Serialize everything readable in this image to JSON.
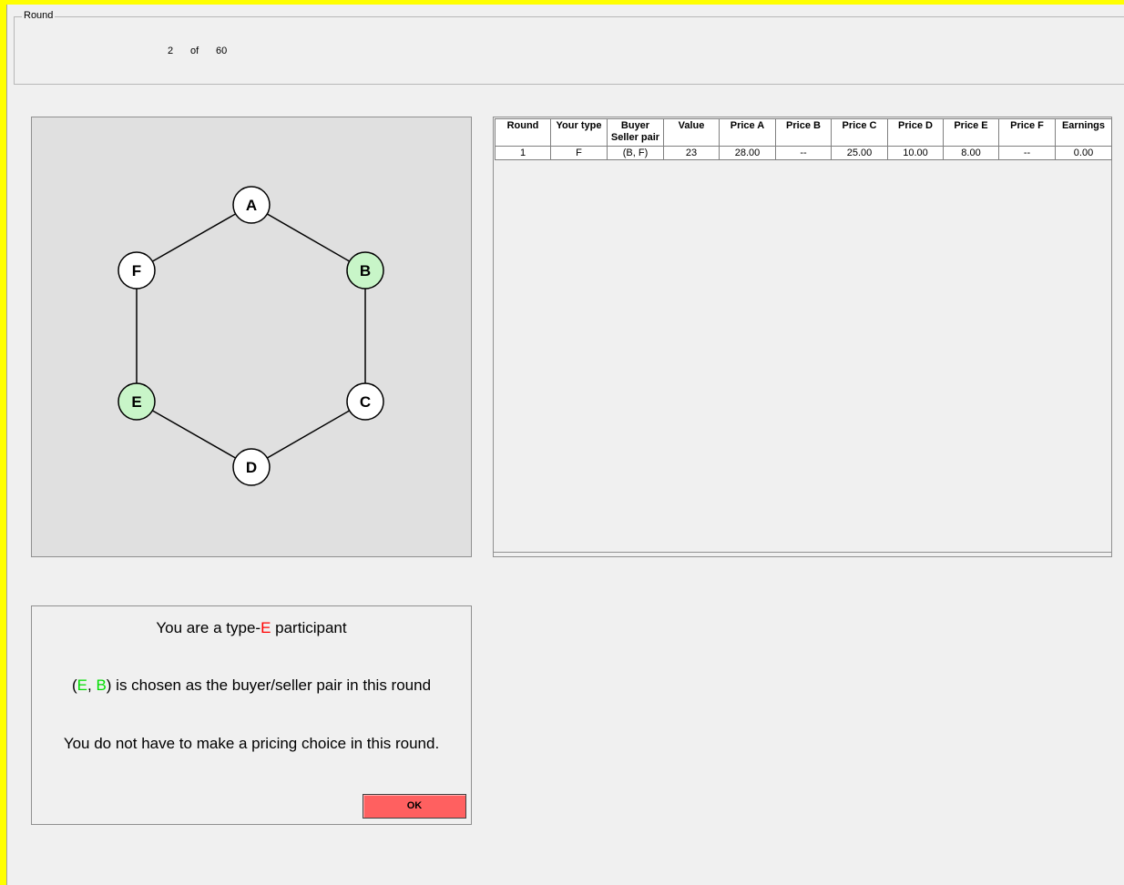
{
  "round": {
    "legend": "Round",
    "current": "2",
    "of_label": "of",
    "total": "60"
  },
  "graph": {
    "nodes": [
      {
        "id": "A",
        "label": "A",
        "fill": "#ffffff"
      },
      {
        "id": "B",
        "label": "B",
        "fill": "#c8f5c8"
      },
      {
        "id": "C",
        "label": "C",
        "fill": "#ffffff"
      },
      {
        "id": "D",
        "label": "D",
        "fill": "#ffffff"
      },
      {
        "id": "E",
        "label": "E",
        "fill": "#c8f5c8"
      },
      {
        "id": "F",
        "label": "F",
        "fill": "#ffffff"
      }
    ],
    "edges": [
      [
        "A",
        "B"
      ],
      [
        "B",
        "C"
      ],
      [
        "C",
        "D"
      ],
      [
        "D",
        "E"
      ],
      [
        "E",
        "F"
      ],
      [
        "F",
        "A"
      ]
    ]
  },
  "history_table": {
    "headers": {
      "round": "Round",
      "your_type": "Your type",
      "pair_line1": "Buyer",
      "pair_line2": "Seller pair",
      "value": "Value",
      "price_a": "Price A",
      "price_b": "Price B",
      "price_c": "Price C",
      "price_d": "Price D",
      "price_e": "Price E",
      "price_f": "Price F",
      "earnings": "Earnings"
    },
    "rows": [
      {
        "round": "1",
        "your_type": "F",
        "pair": "(B, F)",
        "value": "23",
        "price_a": "28.00",
        "price_b": "--",
        "price_c": "25.00",
        "price_d": "10.00",
        "price_e": "8.00",
        "price_f": "--",
        "earnings": "0.00"
      }
    ]
  },
  "message": {
    "line1_prefix": "You are a type-",
    "line1_type": "E",
    "line1_suffix": " participant",
    "line2_open": "(",
    "line2_first": "E",
    "line2_sep": ", ",
    "line2_second": "B",
    "line2_rest": ") is chosen as the buyer/seller pair in this round",
    "line3": "You do not have to make a pricing choice in this round.",
    "ok_label": "OK"
  },
  "colors": {
    "frame": "#ffff00",
    "highlight_node": "#c8f5c8",
    "ok_button": "#ff6060",
    "type_text": "#ff0000",
    "pair_text": "#00dd00"
  }
}
